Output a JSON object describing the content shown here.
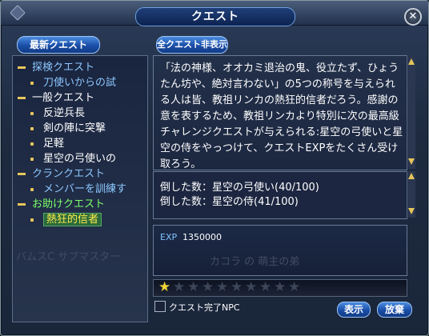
{
  "title": "クエスト",
  "close_glyph": "✕",
  "left_header": "最新クエスト",
  "right_header": "全クエスト非表示",
  "tree": [
    {
      "type": "cat",
      "label": "探検クエスト",
      "color": "#8cc8ff"
    },
    {
      "type": "sub",
      "label": "刀使いからの試",
      "color": "#8cc8ff"
    },
    {
      "type": "cat",
      "label": "一般クエスト",
      "color": "#ffffff"
    },
    {
      "type": "sub",
      "label": "反逆兵長",
      "color": "#ffffff"
    },
    {
      "type": "sub",
      "label": "剣の陣に突撃",
      "color": "#ffffff"
    },
    {
      "type": "sub",
      "label": "足軽",
      "color": "#ffffff"
    },
    {
      "type": "sub",
      "label": "星空の弓使いの",
      "color": "#ffffff"
    },
    {
      "type": "cat",
      "label": "クランクエスト",
      "color": "#8cc8ff"
    },
    {
      "type": "sub",
      "label": "メンバーを訓練す",
      "color": "#8cc8ff"
    },
    {
      "type": "cat",
      "label": "お助けクエスト",
      "color": "#7cff6a"
    },
    {
      "type": "sub",
      "label": "熱狂的信者",
      "color": "#ffe94a",
      "selected": true
    }
  ],
  "watermark": "バムスC サブマスター",
  "description": "「法の神様、オオカミ退治の鬼、役立たず、ひょうたん坊や、絶対言わない」の5つの称号を与えられる人は皆、教祖リンカの熱狂的信者だろう。感謝の意を表するため、教祖リンカより特別に次の最高級チャレンジクエストが与えられる:星空の弓使いと星空の侍をやっつけて、クエストEXPをたくさん受け取ろう。",
  "objectives": [
    "倒した数：星空の弓使い(40/100)",
    "倒した数：星空の侍(41/100)"
  ],
  "reward": {
    "label": "EXP",
    "value": "1350000"
  },
  "reward_watermark": "カコラ の 萌主の弟",
  "difficulty": {
    "filled": 1,
    "total": 10
  },
  "npc_checkbox": {
    "label": "クエスト完了NPC",
    "checked": false
  },
  "buttons": {
    "show": "表示",
    "abandon": "放棄"
  },
  "colors": {
    "accent": "#e6c75a",
    "button": "#1a4ea8",
    "selected_bg": "#2a6a3c"
  }
}
